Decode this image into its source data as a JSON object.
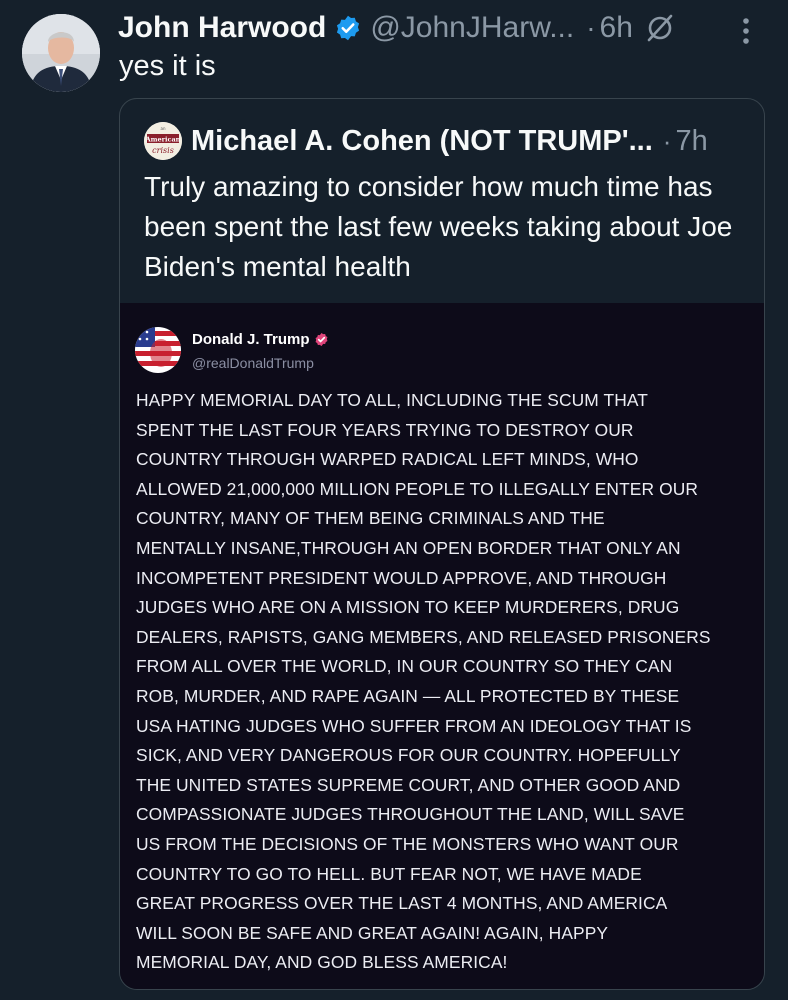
{
  "tweet": {
    "author": {
      "display_name": "John Harwood",
      "handle": "@JohnJHarw...",
      "avatar": "avatar-man-in-suit"
    },
    "time_separator": "·",
    "time": "6h",
    "text": "yes it is",
    "icons": [
      "verified-badge-icon",
      "grok-icon",
      "more-options-icon"
    ]
  },
  "quoted_tweet": {
    "author": {
      "display_name": "Michael A. Cohen (NOT TRUMP'...",
      "avatar": "american-crisis-logo"
    },
    "time_separator": "·",
    "time": "7h",
    "text": "Truly amazing to consider how much time has been spent the last few weeks taking about Joe Biden's mental health"
  },
  "embedded_post": {
    "author": {
      "display_name": "Donald J. Trump",
      "handle": "@realDonaldTrump",
      "avatar": "flag-avatar"
    },
    "lines": [
      "HAPPY MEMORIAL DAY TO ALL, INCLUDING THE SCUM THAT",
      "SPENT THE LAST FOUR YEARS TRYING TO DESTROY OUR",
      "COUNTRY THROUGH WARPED RADICAL LEFT MINDS, WHO",
      "ALLOWED 21,000,000 MILLION PEOPLE TO ILLEGALLY ENTER OUR",
      "COUNTRY, MANY OF THEM BEING CRIMINALS AND THE",
      "MENTALLY INSANE,THROUGH AN OPEN BORDER THAT ONLY AN",
      "INCOMPETENT PRESIDENT WOULD APPROVE, AND THROUGH",
      "JUDGES WHO ARE ON A MISSION TO KEEP MURDERERS, DRUG",
      "DEALERS, RAPISTS, GANG MEMBERS, AND RELEASED PRISONERS",
      "FROM ALL OVER THE WORLD, IN OUR COUNTRY SO THEY CAN",
      "ROB, MURDER, AND RAPE AGAIN — ALL PROTECTED BY THESE",
      "USA HATING JUDGES WHO SUFFER FROM AN IDEOLOGY THAT IS",
      "SICK, AND VERY DANGEROUS FOR OUR COUNTRY. HOPEFULLY",
      "THE UNITED STATES SUPREME COURT, AND OTHER GOOD AND",
      "COMPASSIONATE JUDGES THROUGHOUT THE LAND, WILL SAVE",
      "US FROM THE DECISIONS OF THE MONSTERS WHO WANT OUR",
      "COUNTRY TO GO TO HELL. BUT FEAR NOT, WE HAVE MADE",
      "GREAT PROGRESS OVER THE LAST 4 MONTHS, AND AMERICA",
      "WILL SOON BE SAFE AND GREAT AGAIN! AGAIN, HAPPY",
      "MEMORIAL DAY, AND GOD BLESS AMERICA!"
    ]
  },
  "colors": {
    "background": "#15202b",
    "text_primary": "#f7f9f9",
    "text_secondary": "#8b98a5",
    "verified_blue": "#1d9bf0",
    "embed_background": "#0d0b19",
    "truth_verified": "#e0457b",
    "border": "#38444d"
  }
}
